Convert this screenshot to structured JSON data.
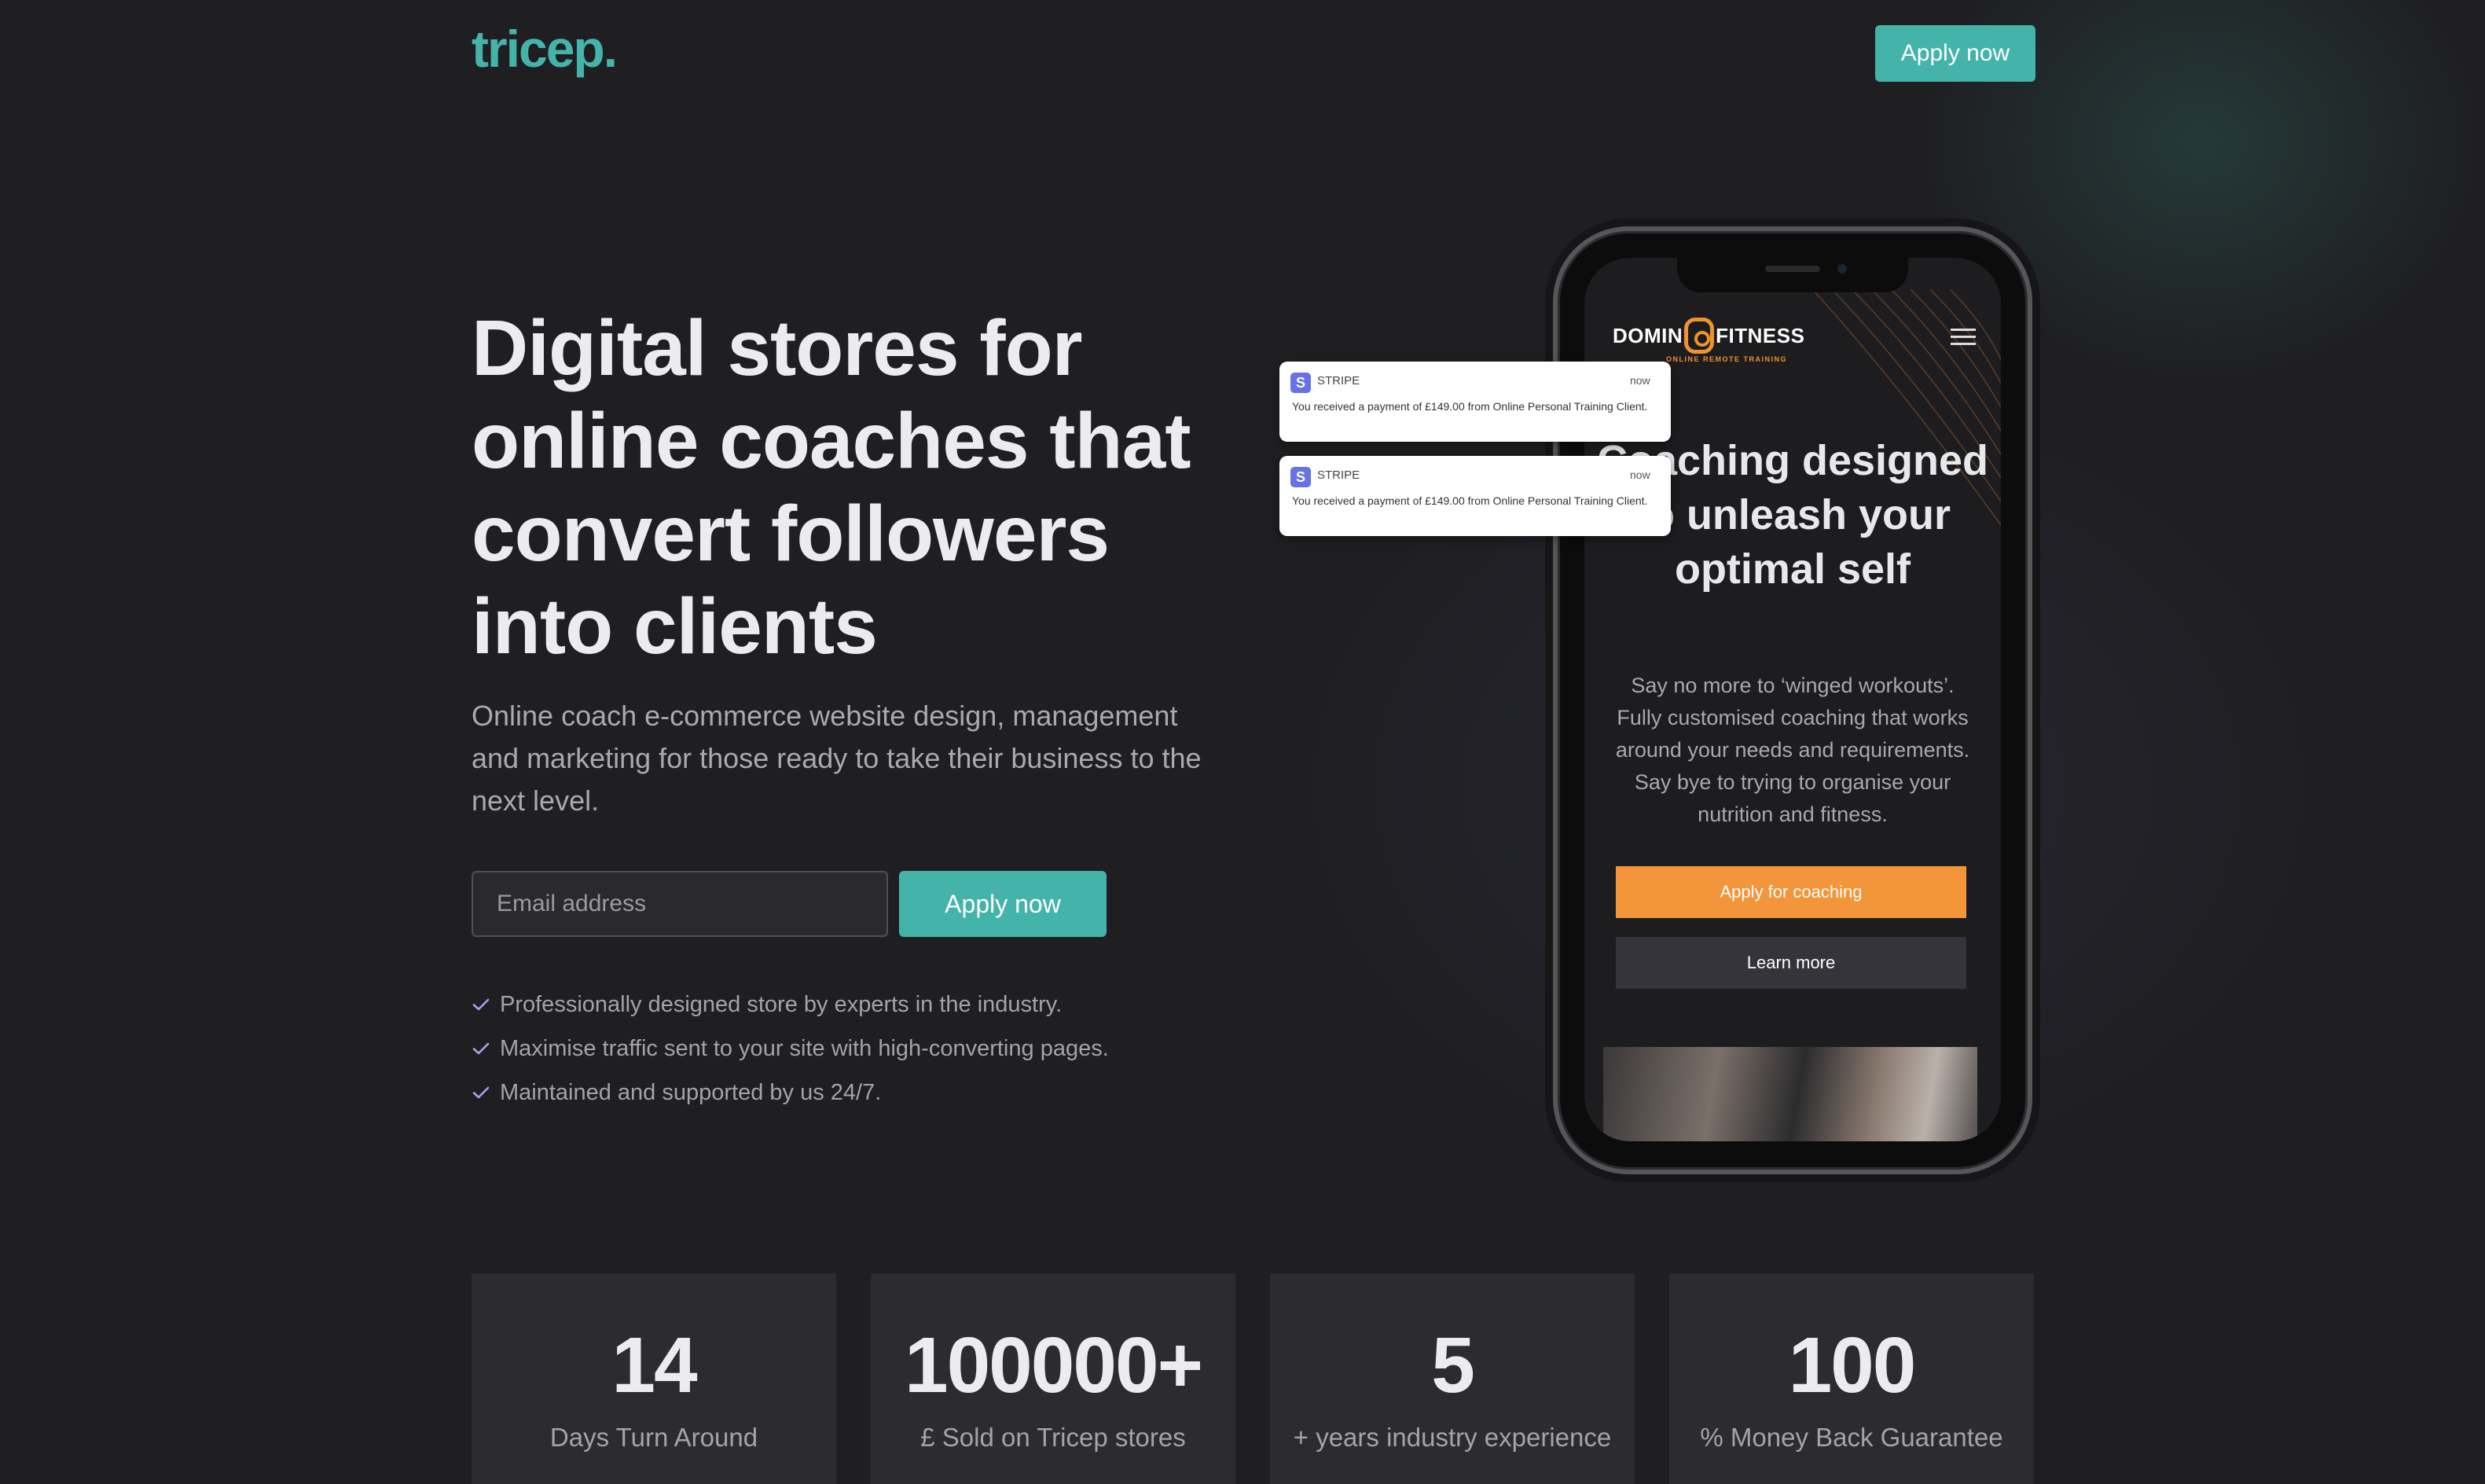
{
  "header": {
    "logo": "tricep.",
    "apply_label": "Apply now"
  },
  "hero": {
    "title": "Digital stores for online coaches that convert followers into clients",
    "subtitle": "Online coach e-commerce website design, management and marketing for those ready to take their business to the next level.",
    "email_placeholder": "Email address",
    "apply_label": "Apply now",
    "checks": [
      "Professionally designed store by experts in the industry.",
      "Maximise traffic sent to your site with high-converting pages.",
      "Maintained and supported by us 24/7."
    ]
  },
  "phone": {
    "brand_left": "DOMIN",
    "brand_right": "FITNESS",
    "brand_tagline": "ONLINE REMOTE TRAINING",
    "title": "Coaching designed to unleash your optimal self",
    "body": "Say no more to ‘winged workouts’. Fully customised coaching that works around your needs and requirements. Say bye to trying to organise your nutrition and fitness.",
    "apply_label": "Apply for coaching",
    "learn_label": "Learn more"
  },
  "notifications": [
    {
      "app": "STRIPE",
      "time": "now",
      "message": "You received a payment of £149.00 from Online Personal Training Client."
    },
    {
      "app": "STRIPE",
      "time": "now",
      "message": "You received a payment of £149.00 from Online Personal Training Client."
    }
  ],
  "stats": [
    {
      "value": "14",
      "label": "Days Turn Around"
    },
    {
      "value": "100000+",
      "label": "£ Sold on Tricep stores"
    },
    {
      "value": "5",
      "label": "+ years industry experience"
    },
    {
      "value": "100",
      "label": "% Money Back Guarantee"
    }
  ],
  "colors": {
    "background": "#1f1f22",
    "accent_teal": "#44b3a9",
    "accent_orange": "#f3953a",
    "check_purple": "#b39cf0",
    "card": "#2c2c30"
  },
  "icons": {
    "check": "check-icon",
    "menu": "menu-icon",
    "stripe": "stripe-icon"
  }
}
